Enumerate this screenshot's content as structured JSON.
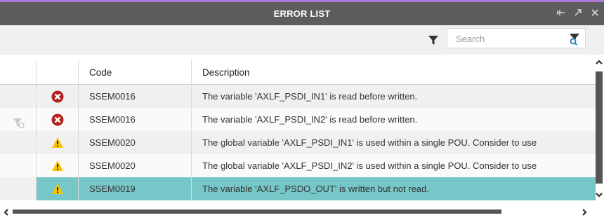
{
  "window": {
    "title": "ERROR LIST",
    "pin_icon": "pin-icon",
    "maximize_icon": "maximize-icon",
    "close_icon": "close-icon",
    "accent_color": "#b07ad8",
    "titlebar_color": "#5d5d5d"
  },
  "toolbar": {
    "filter_icon": "filter-icon",
    "search": {
      "placeholder": "Search",
      "value": ""
    },
    "search_icon": "search-filter-icon"
  },
  "table": {
    "columns": [
      "",
      "",
      "Code",
      "Description"
    ],
    "rows": [
      {
        "severity": "error",
        "code": "SSEM0016",
        "description": "The variable 'AXLF_PSDI_IN1' is read before written.",
        "selected": false
      },
      {
        "severity": "error",
        "code": "SSEM0016",
        "description": "The variable 'AXLF_PSDI_IN2' is read before written.",
        "selected": false
      },
      {
        "severity": "warning",
        "code": "SSEM0020",
        "description": "The global variable 'AXLF_PSDI_IN1' is used within a single POU. Consider to use",
        "selected": false
      },
      {
        "severity": "warning",
        "code": "SSEM0020",
        "description": "The global variable 'AXLF_PSDI_IN2' is used within a single POU. Consider to use",
        "selected": false
      },
      {
        "severity": "warning",
        "code": "SSEM0019",
        "description": "The variable 'AXLF_PSDO_OUT' is written but not read.",
        "selected": true
      }
    ],
    "selection_color": "#77c7c9"
  }
}
